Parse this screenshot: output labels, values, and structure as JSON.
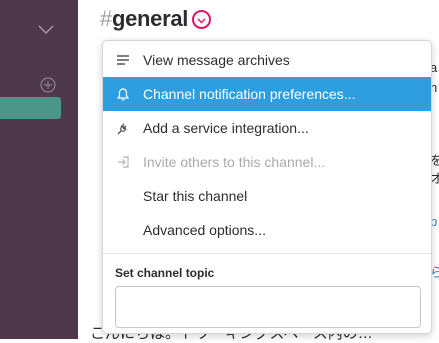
{
  "sidebar": {
    "collapse_icon": "chevron-down-icon",
    "add_icon": "plus-circle-icon"
  },
  "header": {
    "hash": "#",
    "channel_name": "general",
    "menu_toggle_icon": "chevron-down-icon",
    "toggle_ring_color": "#e01563"
  },
  "background": {
    "right_snippets": [
      "a",
      "h",
      "を",
      "オ",
      "p",
      "ら"
    ],
    "bottom_line": "こんにちは。トワーキングスペース内の…"
  },
  "menu": {
    "items": [
      {
        "label": "View message archives",
        "icon": "list-icon",
        "state": "normal"
      },
      {
        "label": "Channel notification preferences...",
        "icon": "bell-icon",
        "state": "highlighted"
      },
      {
        "label": "Add a service integration...",
        "icon": "plug-icon",
        "state": "normal"
      },
      {
        "label": "Invite others to this channel...",
        "icon": "invite-icon",
        "state": "disabled"
      },
      {
        "label": "Star this channel",
        "icon": "",
        "state": "normal"
      },
      {
        "label": "Advanced options...",
        "icon": "",
        "state": "normal"
      }
    ],
    "topic": {
      "label": "Set channel topic",
      "value": ""
    }
  },
  "colors": {
    "sidebar": "#4d394b",
    "sidebar_active": "#4c9689",
    "highlight": "#2d9ee0",
    "disabled_text": "#aaaaae"
  }
}
